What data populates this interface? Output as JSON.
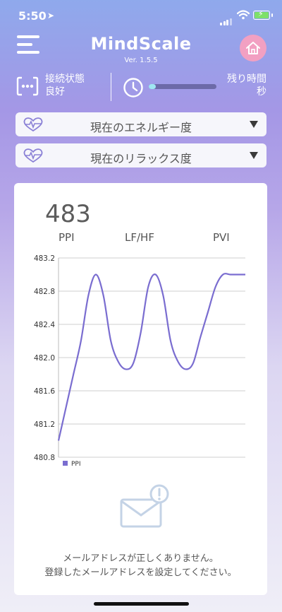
{
  "status_bar": {
    "time": "5:50",
    "location_symbol": "➤"
  },
  "header": {
    "title": "MindScale",
    "version": "Ver. 1.5.5"
  },
  "connection": {
    "label": "接続状態",
    "state": "良好"
  },
  "remaining_time": {
    "label": "残り時間",
    "unit": "秒",
    "progress": 0.05
  },
  "dropdowns": [
    {
      "label": "現在のエネルギー度"
    },
    {
      "label": "現在のリラックス度"
    }
  ],
  "metric": {
    "value": "483",
    "tabs": [
      "PPI",
      "LF/HF",
      "PVI"
    ]
  },
  "colors": {
    "accent": "#7a6dd0",
    "home_button": "#f2a0c2"
  },
  "chart_data": {
    "type": "line",
    "series": [
      {
        "name": "PPI",
        "x": [
          0,
          0.2,
          0.4,
          0.6,
          0.8,
          1.0,
          1.2,
          1.4,
          1.6,
          1.8,
          2.0,
          2.2,
          2.4,
          2.6,
          2.8,
          3.0,
          3.2,
          3.4,
          3.6,
          3.8,
          4.0,
          4.2,
          4.4,
          4.6,
          4.8,
          5.0
        ],
        "values": [
          481.0,
          481.4,
          481.8,
          482.2,
          482.75,
          483.0,
          482.75,
          482.2,
          481.95,
          481.86,
          481.93,
          482.3,
          482.85,
          483.0,
          482.75,
          482.2,
          481.95,
          481.86,
          481.93,
          482.25,
          482.55,
          482.85,
          483.0,
          483.0,
          483.0,
          483.0
        ]
      }
    ],
    "ylim": [
      480.8,
      483.2
    ],
    "yticks": [
      "483.2",
      "482.8",
      "482.4",
      "482.0",
      "481.6",
      "481.2",
      "480.8"
    ],
    "legend": "PPI",
    "grid": true
  },
  "message": {
    "line1": "メールアドレスが正しくありません。",
    "line2": "登録したメールアドレスを設定してください。"
  }
}
